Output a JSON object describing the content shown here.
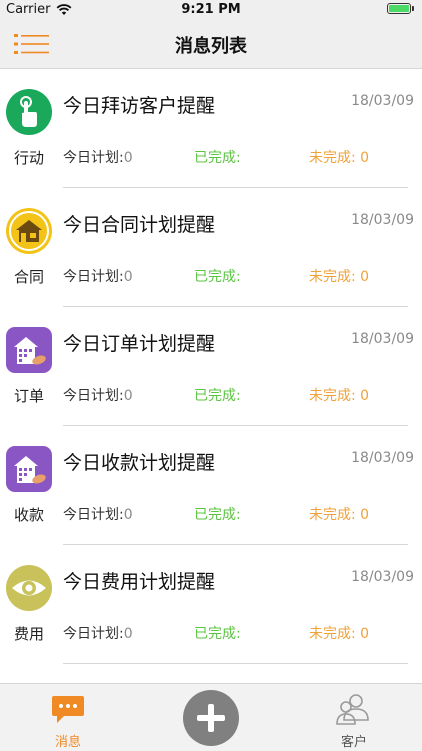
{
  "status_bar": {
    "carrier": "Carrier",
    "time": "9:21 PM"
  },
  "nav": {
    "title": "消息列表",
    "menu_icon": "list-menu-icon"
  },
  "colors": {
    "accent": "#f08a24",
    "done": "#5cc443",
    "todo": "#f0a23a",
    "date": "#8a8a8a"
  },
  "messages": [
    {
      "category": "行动",
      "title": "今日拜访客户提醒",
      "date": "18/03/09",
      "plan_label": "今日计划:",
      "plan_value": "0",
      "done_label": "已完成:",
      "done_value": "",
      "todo_label": "未完成:",
      "todo_value": "0",
      "icon": "touch-hand-icon"
    },
    {
      "category": "合同",
      "title": "今日合同计划提醒",
      "date": "18/03/09",
      "plan_label": "今日计划:",
      "plan_value": "0",
      "done_label": "已完成:",
      "done_value": "",
      "todo_label": "未完成:",
      "todo_value": "0",
      "icon": "house-icon"
    },
    {
      "category": "订单",
      "title": "今日订单计划提醒",
      "date": "18/03/09",
      "plan_label": "今日计划:",
      "plan_value": "0",
      "done_label": "已完成:",
      "done_value": "",
      "todo_label": "未完成:",
      "todo_value": "0",
      "icon": "building-icon"
    },
    {
      "category": "收款",
      "title": "今日收款计划提醒",
      "date": "18/03/09",
      "plan_label": "今日计划:",
      "plan_value": "0",
      "done_label": "已完成:",
      "done_value": "",
      "todo_label": "未完成:",
      "todo_value": "0",
      "icon": "building-icon"
    },
    {
      "category": "费用",
      "title": "今日费用计划提醒",
      "date": "18/03/09",
      "plan_label": "今日计划:",
      "plan_value": "0",
      "done_label": "已完成:",
      "done_value": "",
      "todo_label": "未完成:",
      "todo_value": "0",
      "icon": "eye-icon"
    }
  ],
  "tabbar": {
    "messages_label": "消息",
    "customers_label": "客户",
    "add_icon": "plus-icon"
  }
}
